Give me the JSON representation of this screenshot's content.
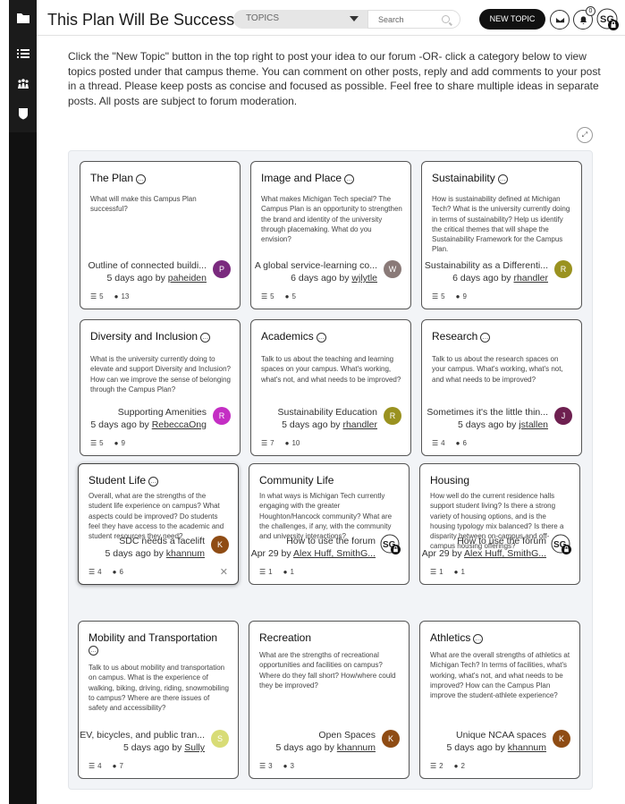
{
  "header": {
    "title": "This Plan Will Be Successful...",
    "topics_label": "TOPICS",
    "search_placeholder": "Search",
    "new_topic_label": "NEW TOPIC",
    "notification_count": "0"
  },
  "intro": "Click the \"New Topic\" button in the top right to post your idea to our forum -OR- click a category below to view topics posted under that campus theme. You can comment on other posts, reply and add comments to your post in a thread. Please keep posts as concise and focused as possible. Feel free to share multiple ideas in separate posts. All posts are subject to forum moderation.",
  "colors": {
    "purple": "#7a2a7e",
    "gray": "#8a7a78",
    "olive": "#9a9220",
    "magenta": "#c42ec4",
    "darkred": "#6e2050",
    "brown": "#8f4c14",
    "lime": "#d8dc76"
  },
  "cards": [
    {
      "title": "The Plan",
      "desc": "What will make this Campus Plan successful?",
      "latest": "Outline of connected buildi...",
      "meta_prefix": "5 days ago by ",
      "user": "paheiden",
      "avatar": "P",
      "topics": "5",
      "posts": "13"
    },
    {
      "title": "Image and Place",
      "desc": "What makes Michigan Tech special? The Campus Plan is an opportunity to strengthen the brand and identity of the university through placemaking. What do you envision?",
      "latest": "A global service-learning co...",
      "meta_prefix": "6 days ago by ",
      "user": "wjlytle",
      "avatar": "W",
      "topics": "5",
      "posts": "5"
    },
    {
      "title": "Sustainability",
      "desc": "How is sustainability defined at Michigan Tech? What is the university currently doing in terms of sustainability? Help us identify the critical themes that will shape the Sustainability Framework for the Campus Plan.",
      "latest": "Sustainability as a Differenti...",
      "meta_prefix": "6 days ago by ",
      "user": "rhandler",
      "avatar": "R",
      "topics": "5",
      "posts": "9"
    },
    {
      "title": "Diversity and Inclusion",
      "desc": "What is the university currently doing to elevate and support Diversity and Inclusion? How can we improve the sense of belonging through the Campus Plan?",
      "latest": "Supporting Amenities",
      "meta_prefix": "5 days ago by ",
      "user": "RebeccaOng",
      "avatar": "R",
      "topics": "5",
      "posts": "9"
    },
    {
      "title": "Academics",
      "desc": "Talk to us about the teaching and learning spaces on your campus. What's working, what's not, and what needs to be improved?",
      "latest": "Sustainability Education",
      "meta_prefix": "5 days ago by ",
      "user": "rhandler",
      "avatar": "R",
      "topics": "7",
      "posts": "10"
    },
    {
      "title": "Research",
      "desc": "Talk to us about the research spaces on your campus. What's working, what's not, and what needs to be improved?",
      "latest": "Sometimes it's the little thin...",
      "meta_prefix": "5 days ago by ",
      "user": "jstallen",
      "avatar": "J",
      "topics": "4",
      "posts": "6"
    },
    {
      "title": "Student Life",
      "desc": "Overall, what are the strengths of the student life experience on campus? What aspects could be improved? Do students feel they have access to the academic and student resources they need?",
      "latest": "SDC needs a facelift",
      "meta_prefix": "5 days ago by ",
      "user": "khannum",
      "avatar": "K",
      "topics": "4",
      "posts": "6"
    },
    {
      "title": "Community Life",
      "desc": "In what ways is Michigan Tech currently engaging with the greater Houghton/Hancock community? What are the challenges, if any, with the community and university interactions?",
      "latest": "How to use the forum",
      "meta_prefix": "Apr 29 by ",
      "user": "Alex Huff, SmithG...",
      "avatar": "SG",
      "topics": "1",
      "posts": "1"
    },
    {
      "title": "Housing",
      "desc": "How well do the current residence halls support student living? Is there a strong variety of housing options, and is the housing typology mix balanced? Is there a disparity between on-campus and off-campus housing offerings?",
      "latest": "How to use the forum",
      "meta_prefix": "Apr 29 by ",
      "user": "Alex Huff, SmithG...",
      "avatar": "SG",
      "topics": "1",
      "posts": "1"
    },
    {
      "title": "Mobility and Transportation",
      "desc": "Talk to us about mobility and transportation on campus. What is the experience of walking, biking, driving, riding, snowmobiling to campus? Where are there issues of safety and accessibility?",
      "latest": "EV, bicycles, and public tran...",
      "meta_prefix": "5 days ago by ",
      "user": "Sully",
      "avatar": "S",
      "topics": "4",
      "posts": "7"
    },
    {
      "title": "Recreation",
      "desc": "What are the strengths of recreational opportunities and facilities on campus? Where do they fall short? How/where could they be improved?",
      "latest": "Open Spaces",
      "meta_prefix": "5 days ago by ",
      "user": "khannum",
      "avatar": "K",
      "topics": "3",
      "posts": "3"
    },
    {
      "title": "Athletics",
      "desc": "What are the overall strengths of athletics at Michigan Tech? In terms of facilities, what's working, what's not, and what needs to be improved? How can the Campus Plan improve the student-athlete experience?",
      "latest": "Unique NCAA spaces",
      "meta_prefix": "5 days ago by ",
      "user": "khannum",
      "avatar": "K",
      "topics": "2",
      "posts": "2"
    }
  ]
}
